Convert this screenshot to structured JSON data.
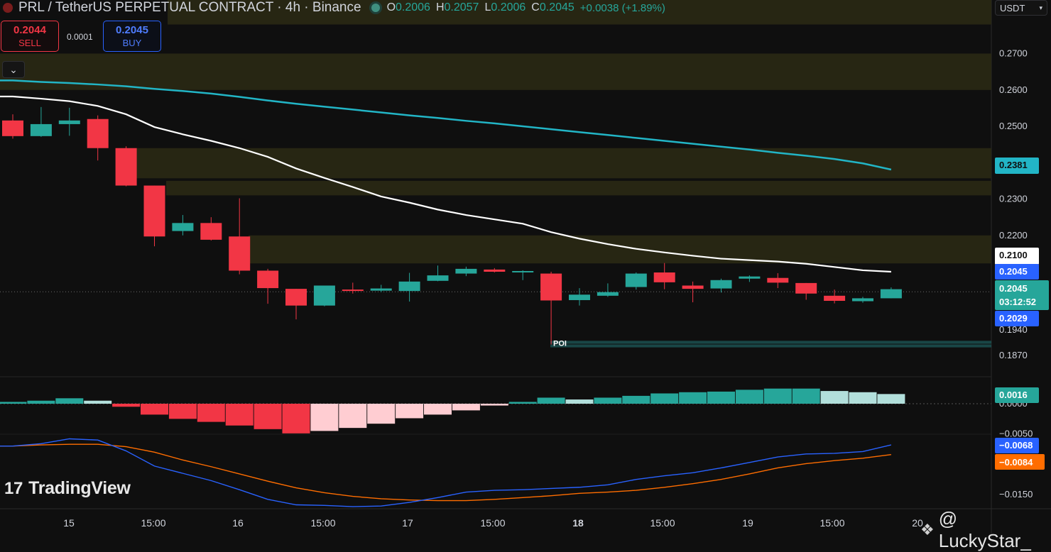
{
  "header": {
    "title": "PRL / TetherUS PERPETUAL CONTRACT · 4h · Binance",
    "open_label": "O",
    "open": "0.2006",
    "high_label": "H",
    "high": "0.2057",
    "low_label": "L",
    "low": "0.2006",
    "close_label": "C",
    "close": "0.2045",
    "change": "+0.0038 (+1.89%)"
  },
  "trade": {
    "sell_price": "0.2044",
    "sell_label": "SELL",
    "spread": "0.0001",
    "buy_price": "0.2045",
    "buy_label": "BUY"
  },
  "currency": {
    "label": "USDT"
  },
  "controls": {
    "collapse_icon": "chevron-down-icon"
  },
  "branding": {
    "logo_mark": "17",
    "logo": "TradingView"
  },
  "watermark": {
    "text": "@ LuckyStar_",
    "icon": "binance-icon"
  },
  "colors": {
    "bg": "#0f0f0f",
    "up": "#26a69a",
    "down": "#f23645",
    "ema_fast": "#ffffff",
    "ema_slow": "#22b5c6",
    "macd_line": "#2962ff",
    "signal_line": "#ff6d00",
    "zone": "#2a2914",
    "poi": "#1d5a59"
  },
  "chart_data": {
    "type": "candlestick",
    "timeframe": "4h",
    "exchange": "Binance",
    "x_labels": [
      "15",
      "15:00",
      "16",
      "15:00",
      "17",
      "15:00",
      "18",
      "15:00",
      "19",
      "15:00",
      "20"
    ],
    "y_ticks_price": [
      "0.2700",
      "0.2600",
      "0.2500",
      "0.2300",
      "0.2200",
      "0.1940",
      "0.1870"
    ],
    "y_ticks_macd": [
      "0.0000",
      "−0.0050",
      "−0.0150"
    ],
    "candles": [
      {
        "o": 0.2516,
        "h": 0.2533,
        "l": 0.2466,
        "c": 0.2473
      },
      {
        "o": 0.2473,
        "h": 0.2553,
        "l": 0.2471,
        "c": 0.2506
      },
      {
        "o": 0.2506,
        "h": 0.2551,
        "l": 0.2474,
        "c": 0.2516
      },
      {
        "o": 0.252,
        "h": 0.253,
        "l": 0.2406,
        "c": 0.244
      },
      {
        "o": 0.244,
        "h": 0.2445,
        "l": 0.2335,
        "c": 0.2337
      },
      {
        "o": 0.2337,
        "h": 0.2337,
        "l": 0.217,
        "c": 0.2197
      },
      {
        "o": 0.2212,
        "h": 0.2256,
        "l": 0.22,
        "c": 0.2234
      },
      {
        "o": 0.2234,
        "h": 0.225,
        "l": 0.2186,
        "c": 0.2188
      },
      {
        "o": 0.2197,
        "h": 0.2302,
        "l": 0.2093,
        "c": 0.2103
      },
      {
        "o": 0.2103,
        "h": 0.2108,
        "l": 0.2012,
        "c": 0.2055
      },
      {
        "o": 0.2053,
        "h": 0.2053,
        "l": 0.1969,
        "c": 0.2007
      },
      {
        "o": 0.2007,
        "h": 0.206,
        "l": 0.2005,
        "c": 0.2062
      },
      {
        "o": 0.2051,
        "h": 0.207,
        "l": 0.204,
        "c": 0.2049
      },
      {
        "o": 0.2048,
        "h": 0.2064,
        "l": 0.2044,
        "c": 0.2054
      },
      {
        "o": 0.2047,
        "h": 0.2097,
        "l": 0.2018,
        "c": 0.2073
      },
      {
        "o": 0.2075,
        "h": 0.2117,
        "l": 0.2074,
        "c": 0.209
      },
      {
        "o": 0.2095,
        "h": 0.2114,
        "l": 0.2088,
        "c": 0.2108
      },
      {
        "o": 0.2106,
        "h": 0.211,
        "l": 0.2098,
        "c": 0.21
      },
      {
        "o": 0.2102,
        "h": 0.2104,
        "l": 0.2077,
        "c": 0.2102
      },
      {
        "o": 0.2095,
        "h": 0.21,
        "l": 0.19,
        "c": 0.2021
      },
      {
        "o": 0.2022,
        "h": 0.2055,
        "l": 0.2007,
        "c": 0.2037
      },
      {
        "o": 0.2034,
        "h": 0.2068,
        "l": 0.2031,
        "c": 0.2044
      },
      {
        "o": 0.2058,
        "h": 0.2098,
        "l": 0.2051,
        "c": 0.2095
      },
      {
        "o": 0.2098,
        "h": 0.2124,
        "l": 0.2052,
        "c": 0.2071
      },
      {
        "o": 0.2062,
        "h": 0.2073,
        "l": 0.2016,
        "c": 0.2053
      },
      {
        "o": 0.2054,
        "h": 0.2081,
        "l": 0.2043,
        "c": 0.2077
      },
      {
        "o": 0.2081,
        "h": 0.209,
        "l": 0.2072,
        "c": 0.2087
      },
      {
        "o": 0.2083,
        "h": 0.2096,
        "l": 0.2055,
        "c": 0.207
      },
      {
        "o": 0.2069,
        "h": 0.2069,
        "l": 0.2023,
        "c": 0.204
      },
      {
        "o": 0.2034,
        "h": 0.2051,
        "l": 0.2013,
        "c": 0.202
      },
      {
        "o": 0.2019,
        "h": 0.2031,
        "l": 0.2015,
        "c": 0.2027
      },
      {
        "o": 0.2027,
        "h": 0.2057,
        "l": 0.2027,
        "c": 0.2052
      }
    ],
    "ema_fast": {
      "color": "#ffffff",
      "last_value": "0.2100",
      "values": [
        0.2582,
        0.2576,
        0.2569,
        0.2556,
        0.2533,
        0.2498,
        0.2478,
        0.246,
        0.244,
        0.2416,
        0.2384,
        0.2358,
        0.2333,
        0.2307,
        0.229,
        0.2271,
        0.2256,
        0.2244,
        0.2232,
        0.2209,
        0.2191,
        0.2176,
        0.2163,
        0.2153,
        0.2144,
        0.2136,
        0.2132,
        0.2128,
        0.2122,
        0.2113,
        0.2104,
        0.21
      ]
    },
    "ema_slow": {
      "color": "#22b5c6",
      "last_value": "0.2381",
      "values": [
        0.2626,
        0.2622,
        0.2619,
        0.2615,
        0.261,
        0.2603,
        0.2597,
        0.259,
        0.2581,
        0.2571,
        0.2562,
        0.2554,
        0.2546,
        0.2538,
        0.253,
        0.2523,
        0.2515,
        0.2508,
        0.25,
        0.2492,
        0.2484,
        0.2476,
        0.2468,
        0.246,
        0.2452,
        0.2444,
        0.2436,
        0.2427,
        0.2419,
        0.241,
        0.2398,
        0.2381
      ]
    },
    "zones": [
      {
        "name": "zone-top",
        "from": 0.278,
        "to": 0.286
      },
      {
        "name": "zone-upper",
        "from": 0.26,
        "to": 0.27
      },
      {
        "name": "zone-mid",
        "from": 0.2357,
        "to": 0.244
      },
      {
        "name": "zone-lower",
        "from": 0.231,
        "to": 0.235
      },
      {
        "name": "zone-resistance",
        "from": 0.2123,
        "to": 0.22
      }
    ],
    "poi": {
      "label": "POI",
      "from": 0.1892,
      "to": 0.191
    },
    "price_labels": {
      "current": "0.2045",
      "countdown": "03:12:52",
      "upper_band": "0.2045",
      "lower_band": "0.2029"
    },
    "macd": {
      "histogram_last": "0.0016",
      "macd_last": "−0.0068",
      "signal_last": "−0.0084",
      "histogram": [
        0.0003,
        0.0005,
        0.0009,
        0.0005,
        -0.0005,
        -0.0018,
        -0.0025,
        -0.003,
        -0.0036,
        -0.0042,
        -0.0049,
        -0.0045,
        -0.004,
        -0.0033,
        -0.0024,
        -0.0018,
        -0.0011,
        -0.0003,
        0.0003,
        0.001,
        0.0007,
        0.001,
        0.0013,
        0.0017,
        0.0019,
        0.002,
        0.0023,
        0.0025,
        0.0025,
        0.0021,
        0.0019,
        0.0016
      ],
      "macd_line": [
        -0.007,
        -0.0066,
        -0.0058,
        -0.006,
        -0.0078,
        -0.0103,
        -0.0115,
        -0.0127,
        -0.0142,
        -0.0158,
        -0.0167,
        -0.0168,
        -0.017,
        -0.0169,
        -0.0163,
        -0.0155,
        -0.0146,
        -0.0143,
        -0.0142,
        -0.014,
        -0.0138,
        -0.0134,
        -0.0125,
        -0.0119,
        -0.0114,
        -0.0106,
        -0.0097,
        -0.0088,
        -0.0083,
        -0.0082,
        -0.0079,
        -0.0068
      ],
      "signal_line": [
        -0.007,
        -0.0068,
        -0.0067,
        -0.0067,
        -0.0071,
        -0.008,
        -0.0093,
        -0.0104,
        -0.0116,
        -0.0128,
        -0.0139,
        -0.0147,
        -0.0153,
        -0.0157,
        -0.0159,
        -0.016,
        -0.016,
        -0.0158,
        -0.0155,
        -0.0152,
        -0.0148,
        -0.0146,
        -0.0143,
        -0.0138,
        -0.0132,
        -0.0125,
        -0.0116,
        -0.0106,
        -0.0099,
        -0.0094,
        -0.009,
        -0.0084
      ]
    }
  }
}
